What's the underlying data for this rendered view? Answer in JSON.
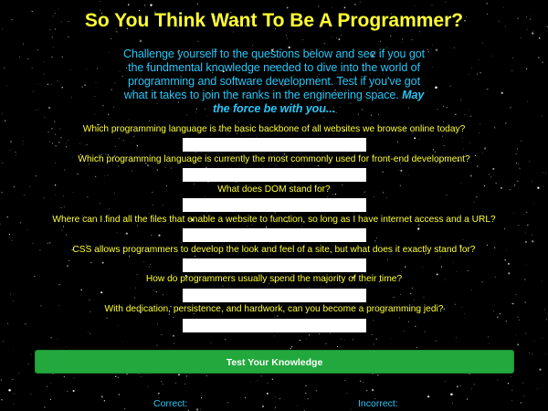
{
  "header": {
    "title": "So You Think Want To Be A Programmer?"
  },
  "intro": {
    "text": "Challenge yourself to the questions below and see if you got the fundmental knowledge needed to dive into the world of programming and software development. Test if you've got what it takes to join the ranks in the engineering space. ",
    "emphasis": "May the force be with you..."
  },
  "quiz": {
    "questions": [
      {
        "label": "Which programming language is the basic backbone of all websites we browse online today?",
        "value": ""
      },
      {
        "label": "Which programming language is currently the most commonly used for front-end development?",
        "value": ""
      },
      {
        "label": "What does DOM stand for?",
        "value": ""
      },
      {
        "label": "Where can I find all the files that enable a website to function, so long as I have internet access and a URL?",
        "value": ""
      },
      {
        "label": "CSS allows programmers to develop the look and feel of a site, but what does it exactly stand for?",
        "value": ""
      },
      {
        "label": "How do programmers usually spend the majority of their time?",
        "value": ""
      },
      {
        "label": "With dedication, persistence, and hardwork, can you become a programming jedi?",
        "value": ""
      }
    ],
    "submit_label": "Test Your Knowledge"
  },
  "results": {
    "correct_label": "Correct:",
    "incorrect_label": "Incorrect:"
  },
  "colors": {
    "background": "#000000",
    "title": "#ffff33",
    "question_text": "#ffff33",
    "intro_text": "#29c5f6",
    "submit_button": "#22a83c"
  }
}
